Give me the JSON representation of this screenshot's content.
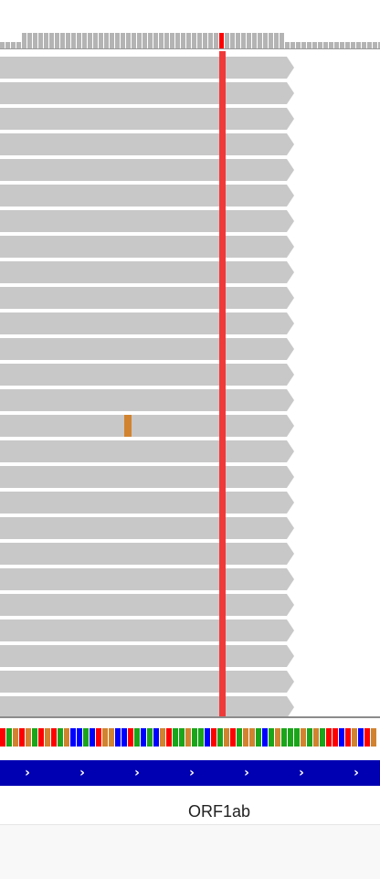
{
  "viewer": {
    "colors": {
      "coverage": "#b4b4b4",
      "coverage_mismatch": "#ff0000",
      "read": "#c8c8c8",
      "mismatch_T": "#f03a3a",
      "mismatch_G": "#d1832f",
      "gene": "#0000b2",
      "gene_arrow": "#ffffff",
      "base_A": "#1ba51b",
      "base_C": "#0000ff",
      "base_G": "#d1832f",
      "base_T": "#ff0000"
    }
  },
  "coverage": {
    "mismatch_base": "T",
    "mismatch_fraction": 1.0
  },
  "alignments": {
    "read_count": 26,
    "strand": "forward",
    "mismatches": [
      {
        "base": "T",
        "reads": "all"
      },
      {
        "base": "G",
        "read_index": 14
      }
    ]
  },
  "sequence": {
    "bases": "TAGTGATGTAGCCACTGGCCTACACGTAAGAACTAGTAGGACAGAAAGAGATTCTGCTG"
  },
  "gene": {
    "name": "ORF1ab",
    "strand_arrow": "›"
  }
}
